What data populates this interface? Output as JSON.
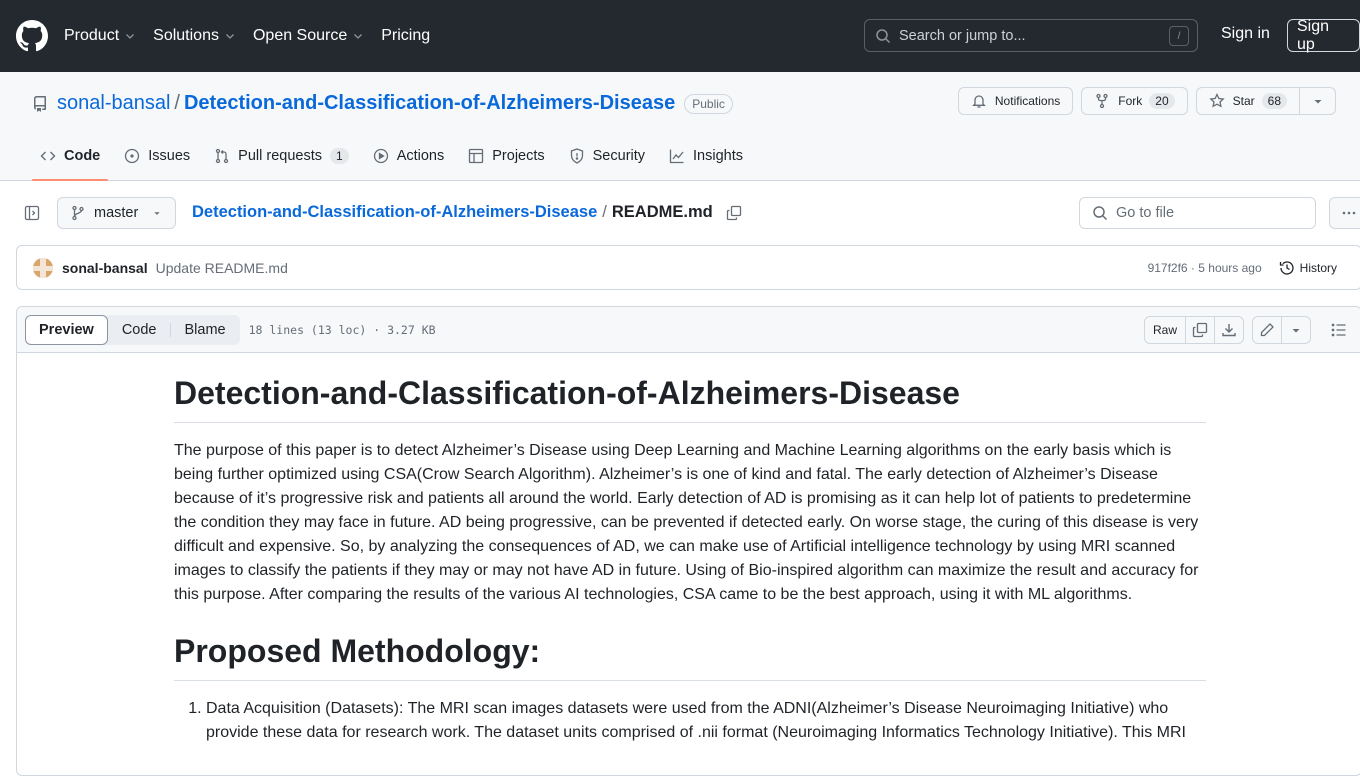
{
  "header": {
    "nav": [
      {
        "label": "Product",
        "dropdown": true
      },
      {
        "label": "Solutions",
        "dropdown": true
      },
      {
        "label": "Open Source",
        "dropdown": true
      },
      {
        "label": "Pricing",
        "dropdown": false
      }
    ],
    "search_placeholder": "Search or jump to...",
    "search_shortcut": "/",
    "sign_in": "Sign in",
    "sign_up": "Sign up"
  },
  "repo": {
    "owner": "sonal-bansal",
    "separator": "/",
    "name": "Detection-and-Classification-of-Alzheimers-Disease",
    "visibility": "Public",
    "notifications_label": "Notifications",
    "fork_label": "Fork",
    "fork_count": "20",
    "star_label": "Star",
    "star_count": "68",
    "tabs": [
      {
        "label": "Code",
        "icon": "code-icon",
        "active": true
      },
      {
        "label": "Issues",
        "icon": "issue-icon"
      },
      {
        "label": "Pull requests",
        "icon": "pull-request-icon",
        "count": "1"
      },
      {
        "label": "Actions",
        "icon": "play-icon"
      },
      {
        "label": "Projects",
        "icon": "table-icon"
      },
      {
        "label": "Security",
        "icon": "shield-icon"
      },
      {
        "label": "Insights",
        "icon": "graph-icon"
      }
    ]
  },
  "file_nav": {
    "branch": "master",
    "breadcrumb_repo": "Detection-and-Classification-of-Alzheimers-Disease",
    "breadcrumb_sep": "/",
    "file_name": "README.md",
    "goto_placeholder": "Go to file"
  },
  "commit": {
    "author": "sonal-bansal",
    "message": "Update README.md",
    "meta": "917f2f6 · 5 hours ago",
    "history_label": "History"
  },
  "file_view": {
    "tabs": [
      "Preview",
      "Code",
      "Blame"
    ],
    "active_tab": "Preview",
    "info": "18 lines (13 loc) · 3.27 KB",
    "raw_label": "Raw"
  },
  "readme": {
    "title": "Detection-and-Classification-of-Alzheimers-Disease",
    "intro": "The purpose of this paper is to detect Alzheimer’s Disease using Deep Learning and Machine Learning algorithms on the early basis which is being further optimized using CSA(Crow Search Algorithm). Alzheimer’s is one of kind and fatal. The early detection of Alzheimer’s Disease because of it’s progressive risk and patients all around the world. Early detection of AD is promising as it can help lot of patients to predetermine the condition they may face in future. AD being progressive, can be prevented if detected early. On worse stage, the curing of this disease is very difficult and expensive. So, by analyzing the consequences of AD, we can make use of Artificial intelligence technology by using MRI scanned images to classify the patients if they may or may not have AD in future. Using of Bio-inspired algorithm can maximize the result and accuracy for this purpose. After comparing the results of the various AI technologies, CSA came to be the best approach, using it with ML algorithms.",
    "section_title": "Proposed Methodology:",
    "list": [
      "Data Acquisition (Datasets): The MRI scan images datasets were used from the ADNI(Alzheimer’s Disease Neuroimaging Initiative) who provide these data for research work. The dataset units comprised of .nii format (Neuroimaging Informatics Technology Initiative). This MRI"
    ]
  }
}
